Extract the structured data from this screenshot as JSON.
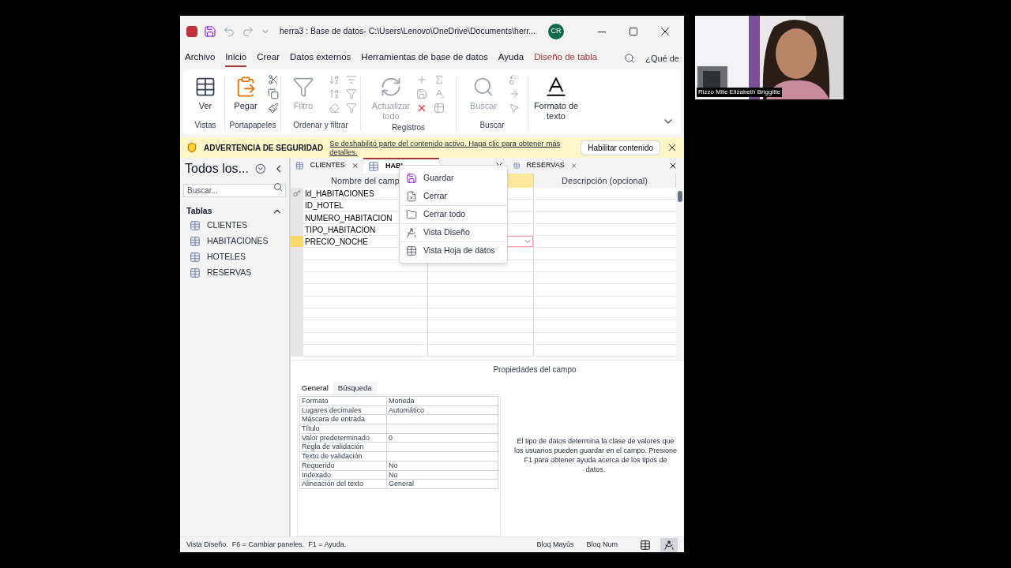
{
  "window": {
    "title": "herra3 : Base de datos- C:\\Users\\Lenovo\\OneDrive\\Documents\\herr...",
    "avatar": "CR"
  },
  "menu_tabs": [
    {
      "label": "Archivo",
      "selected": false,
      "kind": "normal"
    },
    {
      "label": "Inicio",
      "selected": true,
      "kind": "normal"
    },
    {
      "label": "Crear",
      "selected": false,
      "kind": "normal"
    },
    {
      "label": "Datos externos",
      "selected": false,
      "kind": "normal"
    },
    {
      "label": "Herramientas de base de datos",
      "selected": false,
      "kind": "normal"
    },
    {
      "label": "Ayuda",
      "selected": false,
      "kind": "normal"
    },
    {
      "label": "Diseño de tabla",
      "selected": false,
      "kind": "contextual"
    }
  ],
  "tell_me": "¿Qué de",
  "ribbon": {
    "groups": [
      {
        "label": "Vistas",
        "buttons": [
          {
            "label": "Ver",
            "disabled": false
          }
        ]
      },
      {
        "label": "Portapapeles",
        "buttons": [
          {
            "label": "Pegar",
            "disabled": false
          }
        ]
      },
      {
        "label": "Ordenar y filtrar",
        "buttons": [
          {
            "label": "Filtro",
            "disabled": true
          }
        ]
      },
      {
        "label": "Registros",
        "buttons": [
          {
            "label": "Actualizar todo",
            "disabled": true
          }
        ]
      },
      {
        "label": "Buscar",
        "buttons": [
          {
            "label": "Buscar",
            "disabled": true
          }
        ]
      },
      {
        "buttons": [
          {
            "label": "Formato de texto",
            "disabled": false
          }
        ]
      }
    ]
  },
  "security_bar": {
    "title": "ADVERTENCIA DE SEGURIDAD",
    "message": "Se deshabilitó parte del contenido activo. Haga clic para obtener más detalles.",
    "button": "Habilitar contenido"
  },
  "nav_pane": {
    "title": "Todos los...",
    "search": {
      "placeholder": "Buscar..."
    },
    "group": "Tablas",
    "items": [
      {
        "label": "CLIENTES",
        "selected": false
      },
      {
        "label": "HABITACIONES",
        "selected": false
      },
      {
        "label": "HOTELES",
        "selected": false
      },
      {
        "label": "RESERVAS",
        "selected": false
      }
    ]
  },
  "doc_tabs": [
    {
      "label": "CLIENTES",
      "selected": false
    },
    {
      "label": "HABI",
      "selected": true
    },
    {
      "selected": false
    },
    {
      "label": "RESERVAS",
      "selected": false
    }
  ],
  "table": {
    "columns": [
      {
        "label": "Nombre del camp",
        "selected": false
      },
      {
        "selected": true
      },
      {
        "label": "Descripción (opcional)",
        "selected": false
      }
    ],
    "rows": [
      {
        "name": "Id_HABITACIONES",
        "key": true,
        "selected": false
      },
      {
        "name": "ID_HOTEL",
        "key": false,
        "selected": false
      },
      {
        "name": "NUMERO_HABITACION",
        "key": false,
        "selected": false
      },
      {
        "name": "TIPO_HABITACION",
        "key": false,
        "selected": false
      },
      {
        "name": "PRECIO_NOCHE",
        "key": false,
        "selected": true
      }
    ]
  },
  "context_menu": {
    "items": [
      {
        "label": "Guardar"
      },
      {
        "label": "Cerrar"
      },
      {
        "label": "Cerrar todo"
      },
      {
        "label": "Vista Diseño"
      },
      {
        "label": "Vista Hoja de datos"
      }
    ]
  },
  "properties": {
    "title": "Propiedades del campo",
    "tabs": [
      {
        "label": "General",
        "selected": true
      },
      {
        "label": "Búsqueda",
        "selected": false
      }
    ],
    "rows": [
      {
        "label": "Formato",
        "value": "Moneda"
      },
      {
        "label": "Lugares decimales",
        "value": "Automático"
      },
      {
        "label": "Máscara de entrada"
      },
      {
        "label": "Título"
      },
      {
        "label": "Valor predeterminado",
        "value": "0"
      },
      {
        "label": "Regla de validación"
      },
      {
        "label": "Texto de validación"
      },
      {
        "label": "Requerido",
        "value": "No"
      },
      {
        "label": "Indexado",
        "value": "No"
      },
      {
        "label": "Alineación del texto",
        "value": "General"
      }
    ],
    "help": "El tipo de datos determina la clase de valores que los usuarios pueden guardar en el campo. Presione F1 para obtener ayuda acerca de los tipos de datos."
  },
  "status_bar": {
    "text": "Vista Diseño.  F6 = Cambiar paneles.  F1 = Ayuda.",
    "indicators": [
      "Bloq Mayús",
      "Bloq Num"
    ],
    "views": [
      {
        "selected": false
      },
      {
        "selected": true
      }
    ]
  },
  "webcam": {
    "kind": "picture",
    "name": "Rizzo Mite Elizabeth Briggitte"
  }
}
